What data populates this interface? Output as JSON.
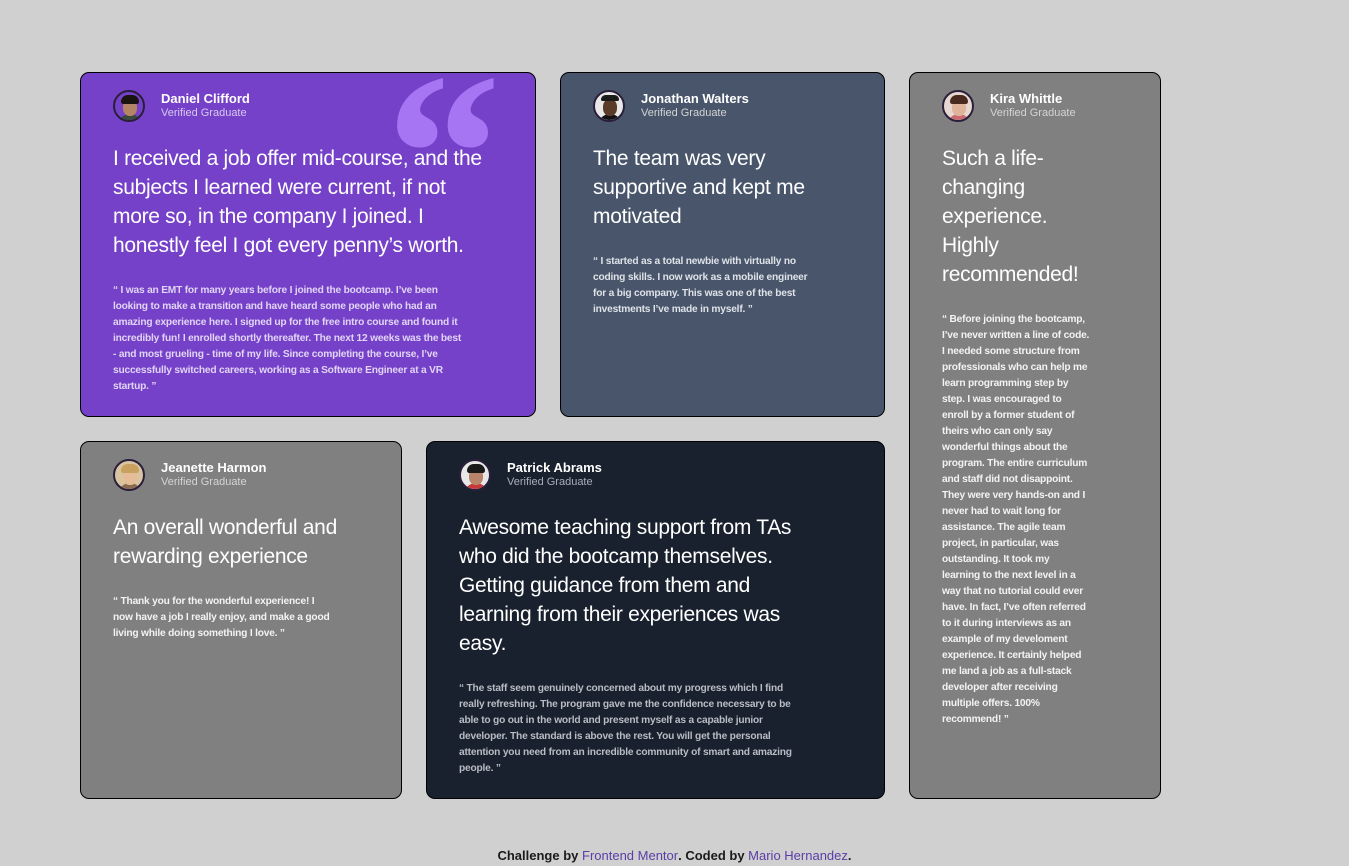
{
  "testimonials": [
    {
      "name": "Daniel Clifford",
      "role": "Verified Graduate",
      "headline": "I received a job offer mid-course, and the subjects I learned were current, if not more so, in the company I joined. I honestly feel I got every penny’s worth.",
      "quote": "“ I was an EMT for many years before I joined the bootcamp. I’ve been looking to make a transition and have heard some people who had an amazing experience here. I signed up for the free intro course and found it incredibly fun! I enrolled shortly thereafter. The next 12 weeks was the best - and most grueling - time of my life. Since completing the course, I’ve successfully switched careers, working as a Software Engineer at a VR startup. ”",
      "quote_mark_icon": "quote-icon",
      "background": "#7541c8"
    },
    {
      "name": "Jonathan Walters",
      "role": "Verified Graduate",
      "headline": "The team was very supportive and kept me motivated",
      "quote": "“ I started as a total newbie with virtually no coding skills. I now work as a mobile engineer for a big company. This was one of the best investments I’ve made in myself. ”",
      "background": "#48556a"
    },
    {
      "name": "Kira Whittle",
      "role": "Verified Graduate",
      "headline": "Such a life-changing experience. Highly recommended!",
      "quote": "“ Before joining the bootcamp, I’ve never written a line of code. I needed some structure from professionals who can help me learn programming step by step. I was encouraged to enroll by a former student of theirs who can only say wonderful things about the program. The entire curriculum and staff did not disappoint. They were very hands-on and I never had to wait long for assistance. The agile team project, in particular, was outstanding. It took my learning to the next level in a way that no tutorial could ever have. In fact, I’ve often referred to it during interviews as an example of my develoment experience. It certainly helped me land a job as a full-stack developer after receiving multiple offers. 100% recommend! ”",
      "background": "#808080"
    },
    {
      "name": "Jeanette Harmon",
      "role": "Verified Graduate",
      "headline": "An overall wonderful and rewarding experience",
      "quote": "“ Thank you for the wonderful experience! I now have a job I really enjoy, and make a good living while doing something I love. ”",
      "background": "#808080"
    },
    {
      "name": "Patrick Abrams",
      "role": "Verified Graduate",
      "headline": "Awesome teaching support from TAs who did the bootcamp themselves. Getting guidance from them and learning from their experiences was easy.",
      "quote": "“ The staff seem genuinely concerned about my progress which I find really refreshing. The program gave me the confidence necessary to be able to go out in the world and present myself as a capable junior developer. The standard is above the rest. You will get the personal attention you need from an incredible community of smart and amazing people. ”",
      "background": "#19212e"
    }
  ],
  "footer": {
    "prefix": "Challenge by ",
    "link1": "Frontend Mentor",
    "middle": ". Coded by ",
    "link2": "Mario Hernandez",
    "suffix": "."
  }
}
